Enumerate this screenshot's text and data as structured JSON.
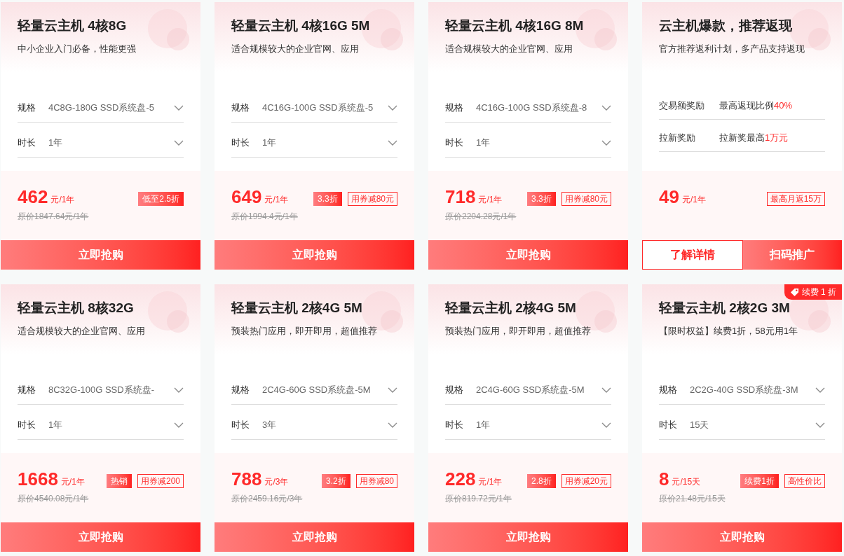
{
  "cards": [
    {
      "kind": "product",
      "title": "轻量云主机 4核8G",
      "subtitle": "中小企业入门必备，性能更强",
      "fields": [
        {
          "label": "规格",
          "value": "4C8G-180G SSD系统盘-5"
        },
        {
          "label": "时长",
          "value": "1年"
        }
      ],
      "price": "462",
      "unit": "元/1年",
      "tags": [
        {
          "kind": "solid",
          "text": "低至2.5折"
        }
      ],
      "original": "原价1847.64元/1年",
      "buttons": [
        {
          "kind": "solid",
          "text": "立即抢购"
        }
      ]
    },
    {
      "kind": "product",
      "title": "轻量云主机 4核16G 5M",
      "subtitle": "适合规模较大的企业官网、应用",
      "fields": [
        {
          "label": "规格",
          "value": "4C16G-100G SSD系统盘-5"
        },
        {
          "label": "时长",
          "value": "1年"
        }
      ],
      "price": "649",
      "unit": "元/1年",
      "tags": [
        {
          "kind": "solid",
          "text": "3.3折"
        },
        {
          "kind": "outline",
          "text": "用券减80元"
        }
      ],
      "original": "原价1994.4元/1年",
      "buttons": [
        {
          "kind": "solid",
          "text": "立即抢购"
        }
      ]
    },
    {
      "kind": "product",
      "title": "轻量云主机 4核16G 8M",
      "subtitle": "适合规模较大的企业官网、应用",
      "fields": [
        {
          "label": "规格",
          "value": "4C16G-100G SSD系统盘-8"
        },
        {
          "label": "时长",
          "value": "1年"
        }
      ],
      "price": "718",
      "unit": "元/1年",
      "tags": [
        {
          "kind": "solid",
          "text": "3.3折"
        },
        {
          "kind": "outline",
          "text": "用券减80元"
        }
      ],
      "original": "原价2204.28元/1年",
      "buttons": [
        {
          "kind": "solid",
          "text": "立即抢购"
        }
      ]
    },
    {
      "kind": "promo",
      "title": "云主机爆款，推荐返现",
      "subtitle": "官方推荐返利计划，多产品支持返现",
      "rewards": [
        {
          "label": "交易额奖励",
          "text": "最高返现比例",
          "highlight": "40%"
        },
        {
          "label": "拉新奖励",
          "text": "拉新奖最高",
          "highlight": "1万元"
        }
      ],
      "price": "49",
      "unit": "元/1年",
      "tags": [
        {
          "kind": "outline",
          "text": "最高月返15万"
        }
      ],
      "buttons": [
        {
          "kind": "outline",
          "text": "了解详情"
        },
        {
          "kind": "solid",
          "text": "扫码推广"
        }
      ]
    },
    {
      "kind": "product",
      "title": "轻量云主机 8核32G",
      "subtitle": "适合规模较大的企业官网、应用",
      "fields": [
        {
          "label": "规格",
          "value": "8C32G-100G SSD系统盘-"
        },
        {
          "label": "时长",
          "value": "1年"
        }
      ],
      "price": "1668",
      "unit": "元/1年",
      "tags": [
        {
          "kind": "solid",
          "text": "热销"
        },
        {
          "kind": "outline",
          "text": "用券减200"
        }
      ],
      "original": "原价4540.08元/1年",
      "buttons": [
        {
          "kind": "solid",
          "text": "立即抢购"
        }
      ]
    },
    {
      "kind": "product",
      "title": "轻量云主机 2核4G 5M",
      "subtitle": "预装热门应用，即开即用，超值推荐",
      "fields": [
        {
          "label": "规格",
          "value": "2C4G-60G SSD系统盘-5M"
        },
        {
          "label": "时长",
          "value": "3年"
        }
      ],
      "price": "788",
      "unit": "元/3年",
      "tags": [
        {
          "kind": "solid",
          "text": "3.2折"
        },
        {
          "kind": "outline",
          "text": "用券减80"
        }
      ],
      "original": "原价2459.16元/3年",
      "buttons": [
        {
          "kind": "solid",
          "text": "立即抢购"
        }
      ]
    },
    {
      "kind": "product",
      "title": "轻量云主机 2核4G 5M",
      "subtitle": "预装热门应用，即开即用，超值推荐",
      "fields": [
        {
          "label": "规格",
          "value": "2C4G-60G SSD系统盘-5M"
        },
        {
          "label": "时长",
          "value": "1年"
        }
      ],
      "price": "228",
      "unit": "元/1年",
      "tags": [
        {
          "kind": "solid",
          "text": "2.8折"
        },
        {
          "kind": "outline",
          "text": "用券减20元"
        }
      ],
      "original": "原价819.72元/1年",
      "buttons": [
        {
          "kind": "solid",
          "text": "立即抢购"
        }
      ]
    },
    {
      "kind": "product",
      "title": "轻量云主机 2核2G 3M",
      "subtitle": "【限时权益】续费1折，58元用1年",
      "corner_badge": "续费 1 折",
      "fields": [
        {
          "label": "规格",
          "value": "2C2G-40G SSD系统盘-3M"
        },
        {
          "label": "时长",
          "value": "15天"
        }
      ],
      "price": "8",
      "unit": "元/15天",
      "tags": [
        {
          "kind": "solid",
          "text": "续费1折"
        },
        {
          "kind": "outline",
          "text": "高性价比"
        }
      ],
      "original": "原价21.48元/15天",
      "buttons": [
        {
          "kind": "solid",
          "text": "立即抢购"
        }
      ]
    }
  ]
}
